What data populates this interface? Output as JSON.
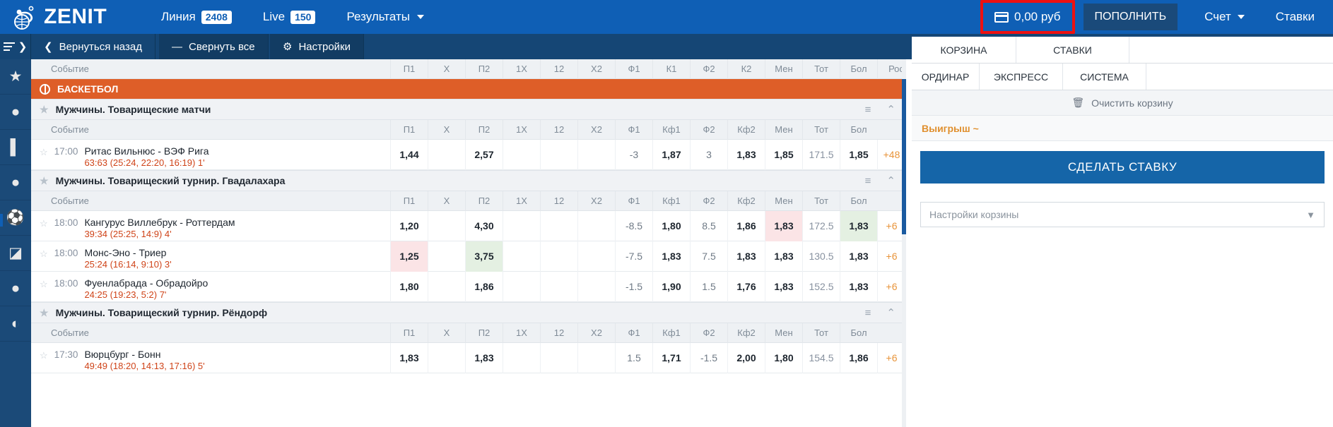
{
  "header": {
    "brand": "ZENIT",
    "nav": [
      {
        "label": "Линия",
        "badge": "2408"
      },
      {
        "label": "Live",
        "badge": "150"
      },
      {
        "label": "Результаты",
        "badge": ""
      }
    ],
    "balance": "0,00 руб",
    "deposit_label": "ПОПОЛНИТЬ",
    "account_label": "Счет",
    "bets_label": "Ставки"
  },
  "toolbar": {
    "back_label": "Вернуться назад",
    "collapse_label": "Свернуть все",
    "settings_label": "Настройки"
  },
  "rail": [
    {
      "icon": "star-icon"
    },
    {
      "icon": "basketball-icon"
    },
    {
      "icon": "handball-icon"
    },
    {
      "icon": "volleyball-icon"
    },
    {
      "icon": "football-icon"
    },
    {
      "icon": "table-tennis-icon"
    },
    {
      "icon": "tennis-icon"
    },
    {
      "icon": "american-football-icon"
    }
  ],
  "table": {
    "event_header": "Событие",
    "top_columns": [
      "П1",
      "X",
      "П2",
      "1X",
      "12",
      "X2",
      "Ф1",
      "К1",
      "Ф2",
      "К2",
      "Мен",
      "Тот",
      "Бол",
      "Рос"
    ],
    "league_columns": [
      "П1",
      "X",
      "П2",
      "1X",
      "12",
      "X2",
      "Ф1",
      "Кф1",
      "Ф2",
      "Кф2",
      "Мен",
      "Тот",
      "Бол"
    ],
    "sport": "БАСКЕТБОЛ",
    "leagues": [
      {
        "name": "Мужчины. Товарищеские матчи",
        "matches": [
          {
            "time": "17:00",
            "name": "Ритас Вильнюс - ВЭФ Рига",
            "score": "63:63 (25:24, 22:20, 16:19) 1'",
            "cells": [
              "1,44",
              "",
              "2,57",
              "",
              "",
              "",
              "-3",
              "1,87",
              "3",
              "1,83",
              "1,85",
              "171.5",
              "1,85"
            ],
            "more": "+48"
          }
        ]
      },
      {
        "name": "Мужчины. Товарищеский турнир. Гвадалахара",
        "matches": [
          {
            "time": "18:00",
            "name": "Кангурус Виллебрук - Роттердам",
            "score": "39:34 (25:25, 14:9) 4'",
            "cells": [
              "1,20",
              "",
              "4,30",
              "",
              "",
              "",
              "-8.5",
              "1,80",
              "8.5",
              "1,86",
              "1,83",
              "172.5",
              "1,83"
            ],
            "more": "+6",
            "highlight": {
              "10": "pink",
              "12": "green"
            }
          },
          {
            "time": "18:00",
            "name": "Монс-Эно - Триер",
            "score": "25:24 (16:14, 9:10) 3'",
            "cells": [
              "1,25",
              "",
              "3,75",
              "",
              "",
              "",
              "-7.5",
              "1,83",
              "7.5",
              "1,83",
              "1,83",
              "130.5",
              "1,83"
            ],
            "more": "+6",
            "highlight": {
              "0": "pink",
              "2": "green"
            }
          },
          {
            "time": "18:00",
            "name": "Фуенлабрада - Обрадойро",
            "score": "24:25 (19:23, 5:2) 7'",
            "cells": [
              "1,80",
              "",
              "1,86",
              "",
              "",
              "",
              "-1.5",
              "1,90",
              "1.5",
              "1,76",
              "1,83",
              "152.5",
              "1,83"
            ],
            "more": "+6"
          }
        ]
      },
      {
        "name": "Мужчины. Товарищеский турнир. Рёндорф",
        "matches": [
          {
            "time": "17:30",
            "name": "Вюрцбург - Бонн",
            "score": "49:49 (18:20, 14:13, 17:16) 5'",
            "cells": [
              "1,83",
              "",
              "1,83",
              "",
              "",
              "",
              "1.5",
              "1,71",
              "-1.5",
              "2,00",
              "1,80",
              "154.5",
              "1,86"
            ],
            "more": "+6"
          }
        ]
      }
    ]
  },
  "betslip": {
    "tabs": [
      "КОРЗИНА",
      "СТАВКИ"
    ],
    "types": [
      "ОРДИНАР",
      "ЭКСПРЕСС",
      "СИСТЕМА"
    ],
    "clear_label": "Очистить корзину",
    "win_label": "Выигрыш ~",
    "make_bet_label": "СДЕЛАТЬ СТАВКУ",
    "settings_label": "Настройки корзины"
  },
  "icons": {
    "card": "card-icon",
    "back_chevron": "chevron-left-icon",
    "dash": "minus-icon",
    "gear": "gear-icon",
    "trash": "trash-icon",
    "list": "list-icon",
    "collapse": "chevron-up-icon"
  },
  "colors": {
    "brand_blue": "#0f5fb5",
    "dark_blue": "#154675",
    "sport_orange": "#de5e28",
    "score_red": "#cf4318",
    "accent_orange": "#e0902f",
    "highlight_red": "#ee1111"
  }
}
